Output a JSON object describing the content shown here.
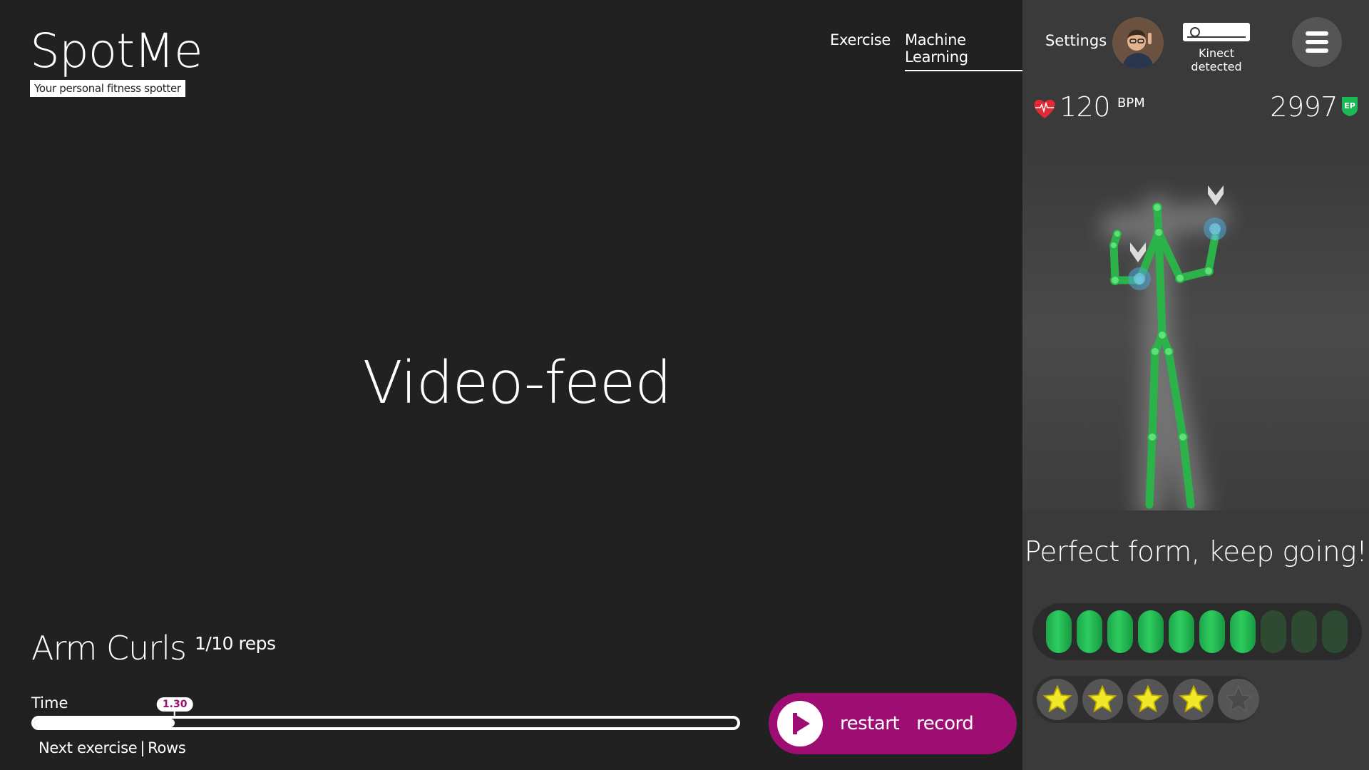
{
  "logo": {
    "title": "SpotMe",
    "tagline": "Your personal fitness spotter"
  },
  "nav": {
    "items": [
      {
        "label": "Exercise",
        "active": false
      },
      {
        "label": "Machine Learning",
        "active": true
      }
    ]
  },
  "video": {
    "label": "Video-feed"
  },
  "exercise": {
    "name": "Arm Curls",
    "reps": "1/10 reps"
  },
  "time": {
    "label": "Time",
    "marker": "1.30",
    "progress": 0.2
  },
  "next": {
    "prefix": "Next exercise",
    "separator": "|",
    "name": "Rows"
  },
  "controls": {
    "restart": "restart",
    "record": "record"
  },
  "sidebar": {
    "settings": "Settings",
    "kinect": "Kinect detected",
    "heart": {
      "value": "120",
      "unit": "BPM"
    },
    "ep": {
      "value": "2997",
      "badge": "EP"
    },
    "feedback": "Perfect form, keep going!",
    "pills": {
      "filled": 7,
      "total": 10
    },
    "stars": {
      "filled": 4,
      "total": 5
    }
  },
  "colors": {
    "accent": "#9e0e72",
    "green": "#2ecc5f",
    "background": "#222122",
    "sidebar": "#3a3a3a"
  }
}
